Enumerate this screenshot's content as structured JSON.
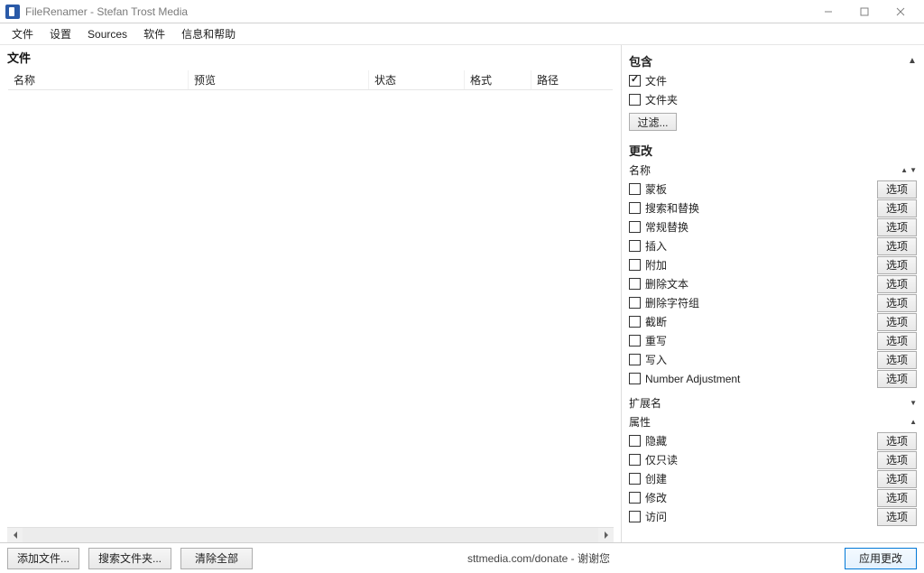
{
  "window": {
    "title": "FileRenamer - Stefan Trost Media"
  },
  "menubar": [
    "文件",
    "设置",
    "Sources",
    "软件",
    "信息和帮助"
  ],
  "left_panel": {
    "title": "文件",
    "columns": {
      "name": "名称",
      "preview": "预览",
      "status": "状态",
      "format": "格式",
      "path": "路径"
    }
  },
  "right_panel": {
    "include": {
      "header": "包含",
      "files": {
        "label": "文件",
        "checked": true
      },
      "folders": {
        "label": "文件夹",
        "checked": false
      },
      "filter_button": "过滤..."
    },
    "change": {
      "header": "更改",
      "name_sub": "名称",
      "options_label": "选项",
      "name_items": [
        {
          "label": "蒙板",
          "checked": false
        },
        {
          "label": "搜索和替换",
          "checked": false
        },
        {
          "label": "常规替换",
          "checked": false
        },
        {
          "label": "插入",
          "checked": false
        },
        {
          "label": "附加",
          "checked": false
        },
        {
          "label": "删除文本",
          "checked": false
        },
        {
          "label": "删除字符组",
          "checked": false
        },
        {
          "label": "截断",
          "checked": false
        },
        {
          "label": "重写",
          "checked": false
        },
        {
          "label": "写入",
          "checked": false
        },
        {
          "label": "Number Adjustment",
          "checked": false
        }
      ],
      "ext_sub": "扩展名",
      "attr_sub": "属性",
      "attr_items": [
        {
          "label": "隐藏",
          "checked": false
        },
        {
          "label": "仅只读",
          "checked": false
        },
        {
          "label": "创建",
          "checked": false
        },
        {
          "label": "修改",
          "checked": false
        },
        {
          "label": "访问",
          "checked": false
        }
      ]
    }
  },
  "bottom": {
    "add_files": "添加文件...",
    "search_folders": "搜索文件夹...",
    "clear_all": "清除全部",
    "donate": "sttmedia.com/donate - 谢谢您",
    "apply": "应用更改"
  }
}
